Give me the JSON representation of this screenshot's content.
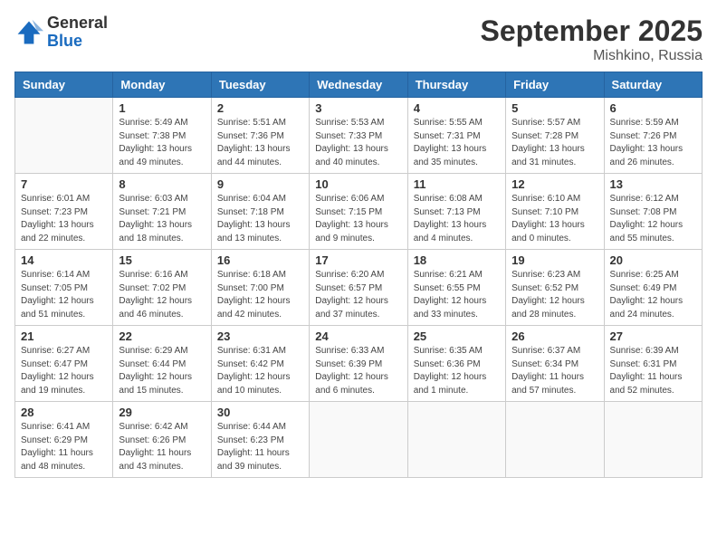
{
  "header": {
    "logo_general": "General",
    "logo_blue": "Blue",
    "month_title": "September 2025",
    "location": "Mishkino, Russia"
  },
  "weekdays": [
    "Sunday",
    "Monday",
    "Tuesday",
    "Wednesday",
    "Thursday",
    "Friday",
    "Saturday"
  ],
  "weeks": [
    [
      {
        "day": "",
        "info": ""
      },
      {
        "day": "1",
        "info": "Sunrise: 5:49 AM\nSunset: 7:38 PM\nDaylight: 13 hours\nand 49 minutes."
      },
      {
        "day": "2",
        "info": "Sunrise: 5:51 AM\nSunset: 7:36 PM\nDaylight: 13 hours\nand 44 minutes."
      },
      {
        "day": "3",
        "info": "Sunrise: 5:53 AM\nSunset: 7:33 PM\nDaylight: 13 hours\nand 40 minutes."
      },
      {
        "day": "4",
        "info": "Sunrise: 5:55 AM\nSunset: 7:31 PM\nDaylight: 13 hours\nand 35 minutes."
      },
      {
        "day": "5",
        "info": "Sunrise: 5:57 AM\nSunset: 7:28 PM\nDaylight: 13 hours\nand 31 minutes."
      },
      {
        "day": "6",
        "info": "Sunrise: 5:59 AM\nSunset: 7:26 PM\nDaylight: 13 hours\nand 26 minutes."
      }
    ],
    [
      {
        "day": "7",
        "info": "Sunrise: 6:01 AM\nSunset: 7:23 PM\nDaylight: 13 hours\nand 22 minutes."
      },
      {
        "day": "8",
        "info": "Sunrise: 6:03 AM\nSunset: 7:21 PM\nDaylight: 13 hours\nand 18 minutes."
      },
      {
        "day": "9",
        "info": "Sunrise: 6:04 AM\nSunset: 7:18 PM\nDaylight: 13 hours\nand 13 minutes."
      },
      {
        "day": "10",
        "info": "Sunrise: 6:06 AM\nSunset: 7:15 PM\nDaylight: 13 hours\nand 9 minutes."
      },
      {
        "day": "11",
        "info": "Sunrise: 6:08 AM\nSunset: 7:13 PM\nDaylight: 13 hours\nand 4 minutes."
      },
      {
        "day": "12",
        "info": "Sunrise: 6:10 AM\nSunset: 7:10 PM\nDaylight: 13 hours\nand 0 minutes."
      },
      {
        "day": "13",
        "info": "Sunrise: 6:12 AM\nSunset: 7:08 PM\nDaylight: 12 hours\nand 55 minutes."
      }
    ],
    [
      {
        "day": "14",
        "info": "Sunrise: 6:14 AM\nSunset: 7:05 PM\nDaylight: 12 hours\nand 51 minutes."
      },
      {
        "day": "15",
        "info": "Sunrise: 6:16 AM\nSunset: 7:02 PM\nDaylight: 12 hours\nand 46 minutes."
      },
      {
        "day": "16",
        "info": "Sunrise: 6:18 AM\nSunset: 7:00 PM\nDaylight: 12 hours\nand 42 minutes."
      },
      {
        "day": "17",
        "info": "Sunrise: 6:20 AM\nSunset: 6:57 PM\nDaylight: 12 hours\nand 37 minutes."
      },
      {
        "day": "18",
        "info": "Sunrise: 6:21 AM\nSunset: 6:55 PM\nDaylight: 12 hours\nand 33 minutes."
      },
      {
        "day": "19",
        "info": "Sunrise: 6:23 AM\nSunset: 6:52 PM\nDaylight: 12 hours\nand 28 minutes."
      },
      {
        "day": "20",
        "info": "Sunrise: 6:25 AM\nSunset: 6:49 PM\nDaylight: 12 hours\nand 24 minutes."
      }
    ],
    [
      {
        "day": "21",
        "info": "Sunrise: 6:27 AM\nSunset: 6:47 PM\nDaylight: 12 hours\nand 19 minutes."
      },
      {
        "day": "22",
        "info": "Sunrise: 6:29 AM\nSunset: 6:44 PM\nDaylight: 12 hours\nand 15 minutes."
      },
      {
        "day": "23",
        "info": "Sunrise: 6:31 AM\nSunset: 6:42 PM\nDaylight: 12 hours\nand 10 minutes."
      },
      {
        "day": "24",
        "info": "Sunrise: 6:33 AM\nSunset: 6:39 PM\nDaylight: 12 hours\nand 6 minutes."
      },
      {
        "day": "25",
        "info": "Sunrise: 6:35 AM\nSunset: 6:36 PM\nDaylight: 12 hours\nand 1 minute."
      },
      {
        "day": "26",
        "info": "Sunrise: 6:37 AM\nSunset: 6:34 PM\nDaylight: 11 hours\nand 57 minutes."
      },
      {
        "day": "27",
        "info": "Sunrise: 6:39 AM\nSunset: 6:31 PM\nDaylight: 11 hours\nand 52 minutes."
      }
    ],
    [
      {
        "day": "28",
        "info": "Sunrise: 6:41 AM\nSunset: 6:29 PM\nDaylight: 11 hours\nand 48 minutes."
      },
      {
        "day": "29",
        "info": "Sunrise: 6:42 AM\nSunset: 6:26 PM\nDaylight: 11 hours\nand 43 minutes."
      },
      {
        "day": "30",
        "info": "Sunrise: 6:44 AM\nSunset: 6:23 PM\nDaylight: 11 hours\nand 39 minutes."
      },
      {
        "day": "",
        "info": ""
      },
      {
        "day": "",
        "info": ""
      },
      {
        "day": "",
        "info": ""
      },
      {
        "day": "",
        "info": ""
      }
    ]
  ]
}
